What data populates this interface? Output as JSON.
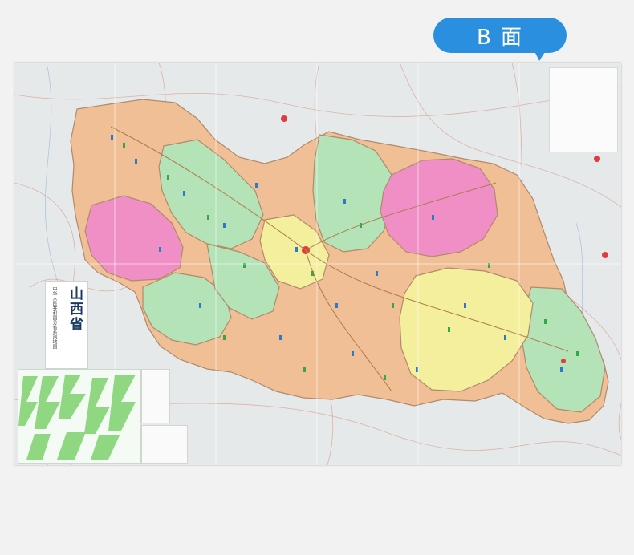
{
  "badge": {
    "label": "B 面"
  },
  "map": {
    "title": "山西省",
    "subtitle": "中华人民共和国分省系列地图",
    "colors": {
      "orange": "#f1bf96",
      "pink": "#ef8fc6",
      "green": "#b3e3b6",
      "yellow": "#f3ef9c",
      "outer": "#e3e6e8",
      "border": "#a58063",
      "accent": "#2b8fe0"
    }
  }
}
